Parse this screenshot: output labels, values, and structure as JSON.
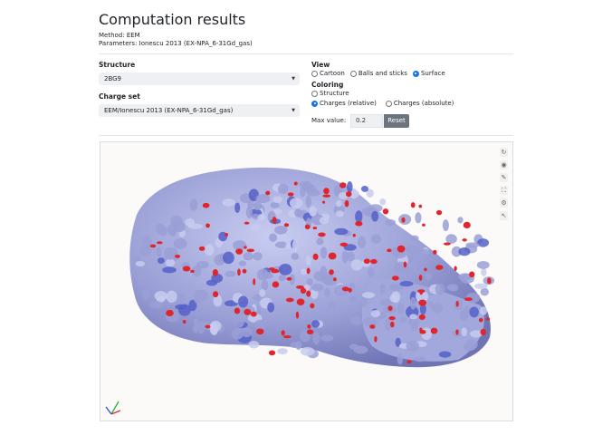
{
  "page": {
    "title": "Computation results",
    "method": "Method: EEM",
    "parameters": "Parameters: Ionescu 2013 (EX-NPA_6-31Gd_gas)"
  },
  "structure": {
    "label": "Structure",
    "value": "2BG9"
  },
  "charge_set": {
    "label": "Charge set",
    "value": "EEM/Ionescu 2013 (EX-NPA_6-31Gd_gas)"
  },
  "view": {
    "label": "View",
    "options": [
      "Cartoon",
      "Balls and sticks",
      "Surface"
    ],
    "selected": "Surface"
  },
  "coloring": {
    "label": "Coloring",
    "options": [
      "Structure",
      "Charges (relative)",
      "Charges (absolute)"
    ],
    "selected": "Charges (relative)"
  },
  "max_value": {
    "label": "Max value:",
    "value": "0.2",
    "reset_label": "Reset"
  },
  "viewer": {
    "tools": [
      "refresh-icon",
      "camera-icon",
      "wrench-icon",
      "expand-icon",
      "settings-icon",
      "cursor-icon"
    ],
    "colors": {
      "surface": "#9a9fd6",
      "negative": "#e0262c",
      "positive": "#5560c8"
    }
  }
}
